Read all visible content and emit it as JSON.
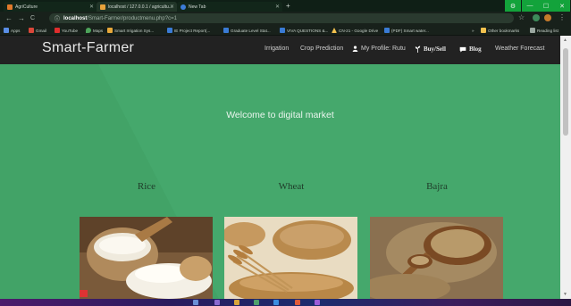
{
  "browser": {
    "tabs": [
      {
        "title": "AgriCulture",
        "color": "#e0792b"
      },
      {
        "title": "localhost / 127.0.0.1 / agricultu...",
        "color": "#e8a33b"
      },
      {
        "title": "New Tab",
        "color": "#3c7cd8"
      }
    ],
    "new_tab_glyph": "+",
    "window_controls": {
      "gear": "⚙",
      "minimize": "—",
      "maximize": "☐",
      "close": "✕"
    },
    "nav": {
      "back": "←",
      "forward": "→",
      "reload": "C"
    },
    "url_host": "localhost",
    "url_path": "/Smart-Farmer/productmenu.php?c=1",
    "star_glyph": "☆",
    "menu_glyph": "⋮",
    "bookmarks": [
      {
        "label": "Apps",
        "color": "#5a8ee6"
      },
      {
        "label": "Gmail",
        "color": "#d9473a"
      },
      {
        "label": "YouTube",
        "color": "#e02d2d"
      },
      {
        "label": "Maps",
        "color": "#4da35a"
      },
      {
        "label": "Smart Irrigation Sys...",
        "color": "#e8a83a"
      },
      {
        "label": "IE Project Report(...",
        "color": "#3a7bd5"
      },
      {
        "label": "Graduate Level Stat...",
        "color": "#3a7bd5"
      },
      {
        "label": "VIVA QUESTIONS &...",
        "color": "#3a7bd5"
      },
      {
        "label": "CN-21 - Google Drive",
        "color": "#f2c14e"
      },
      {
        "label": "(PDF) Smart water...",
        "color": "#3a7bd5"
      },
      {
        "label": "Other bookmarks",
        "color": "#f2c14e"
      },
      {
        "label": "Reading list",
        "color": "#9aa7a0"
      }
    ],
    "bookmarks_overflow": "»"
  },
  "site": {
    "brand": "Smart-Farmer",
    "nav": [
      {
        "label": "Irrigation",
        "icon": "",
        "bold": false
      },
      {
        "label": "Crop Prediction",
        "icon": "",
        "bold": false
      },
      {
        "label": "My Profile: Rutu",
        "icon": "user-icon",
        "bold": false
      },
      {
        "label": "Buy/Sell",
        "icon": "plant-icon",
        "bold": true
      },
      {
        "label": "Blog",
        "icon": "comment-icon",
        "bold": true
      },
      {
        "label": "Weather Forecast",
        "icon": "",
        "bold": false
      }
    ],
    "welcome": "Welcome to digital market",
    "products": [
      {
        "name": "Rice"
      },
      {
        "name": "Wheat"
      },
      {
        "name": "Bajra"
      }
    ]
  },
  "colors": {
    "page_green": "#45a86c",
    "nav_dark": "#222222",
    "window_green": "#13a33b"
  }
}
